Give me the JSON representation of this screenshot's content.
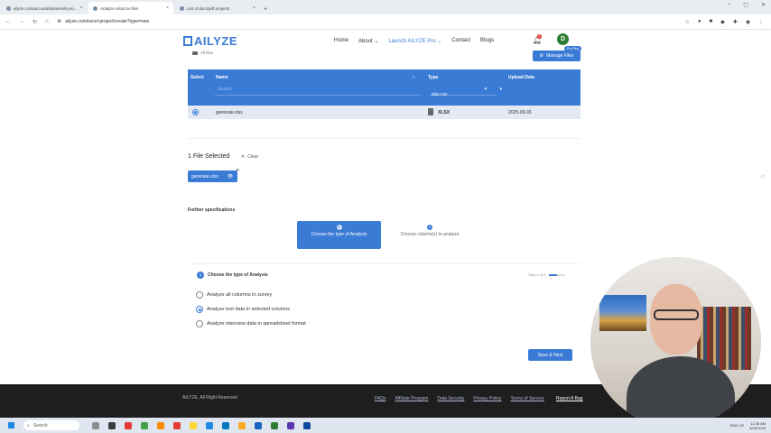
{
  "browser": {
    "tabs": [
      {
        "title": "ailyze.com/account/ideas/edit-pro..."
      },
      {
        "title": "Analyze xlsx/csv files"
      },
      {
        "title": "List of docs/pdf projects"
      }
    ],
    "new_tab": "+",
    "url": "ailyze.com/excel-project/create?type=new"
  },
  "header": {
    "logo_text": "AILYZE",
    "nav": [
      "Home",
      "About ⌄",
      "Launch AILYZE Pro ⌄",
      "Contact",
      "Blogs"
    ],
    "notification_count": "1",
    "avatar_initial": "D",
    "pro_badge": "Pro Plus"
  },
  "breadcrumb": "All files",
  "manage_files_label": "Manage Files",
  "file_table": {
    "headers": {
      "select": "Select",
      "name": "Name",
      "type": "Type",
      "upload_date": "Upload Date"
    },
    "search_placeholder": "Search",
    "type_filter": "xlsx csv",
    "rows": [
      {
        "name": "generate.xlsx",
        "type": "XLSX",
        "upload_date": "2025-09-03"
      }
    ]
  },
  "selection": {
    "count_label": "1 File Selected",
    "clear_label": "Clear",
    "chip_label": "generate.xlsx"
  },
  "further_specifications": "Further specifications",
  "steps": [
    {
      "num": "1",
      "label": "Choose the type of Analysis"
    },
    {
      "num": "2",
      "label": "Choose column(s) to analyze"
    }
  ],
  "analysis": {
    "title": "Choose the type of Analysis",
    "step_indicator": "Step 1 of 2",
    "progress": 0.5,
    "options": [
      {
        "label": "Analyze all columns in survey",
        "checked": false
      },
      {
        "label": "Analyze text data in selected columns",
        "checked": true
      },
      {
        "label": "Analyze interview data in spreadsheet format",
        "checked": false
      }
    ],
    "save_next_label": "Save & Next"
  },
  "footer": {
    "copyright": "AILYZE, All Right Reserved",
    "links": [
      "FAQs",
      "Affiliate Program",
      "Data Security",
      "Privacy Policy",
      "Terms of Service"
    ],
    "report_bug": "Report A Bug"
  },
  "taskbar": {
    "search_label": "Search",
    "lang": "ENG US",
    "time": "11:36 AM",
    "date": "6/09/2025"
  },
  "colors": {
    "accent": "#3a7bd5",
    "footer_bg": "#1e1e1e"
  }
}
